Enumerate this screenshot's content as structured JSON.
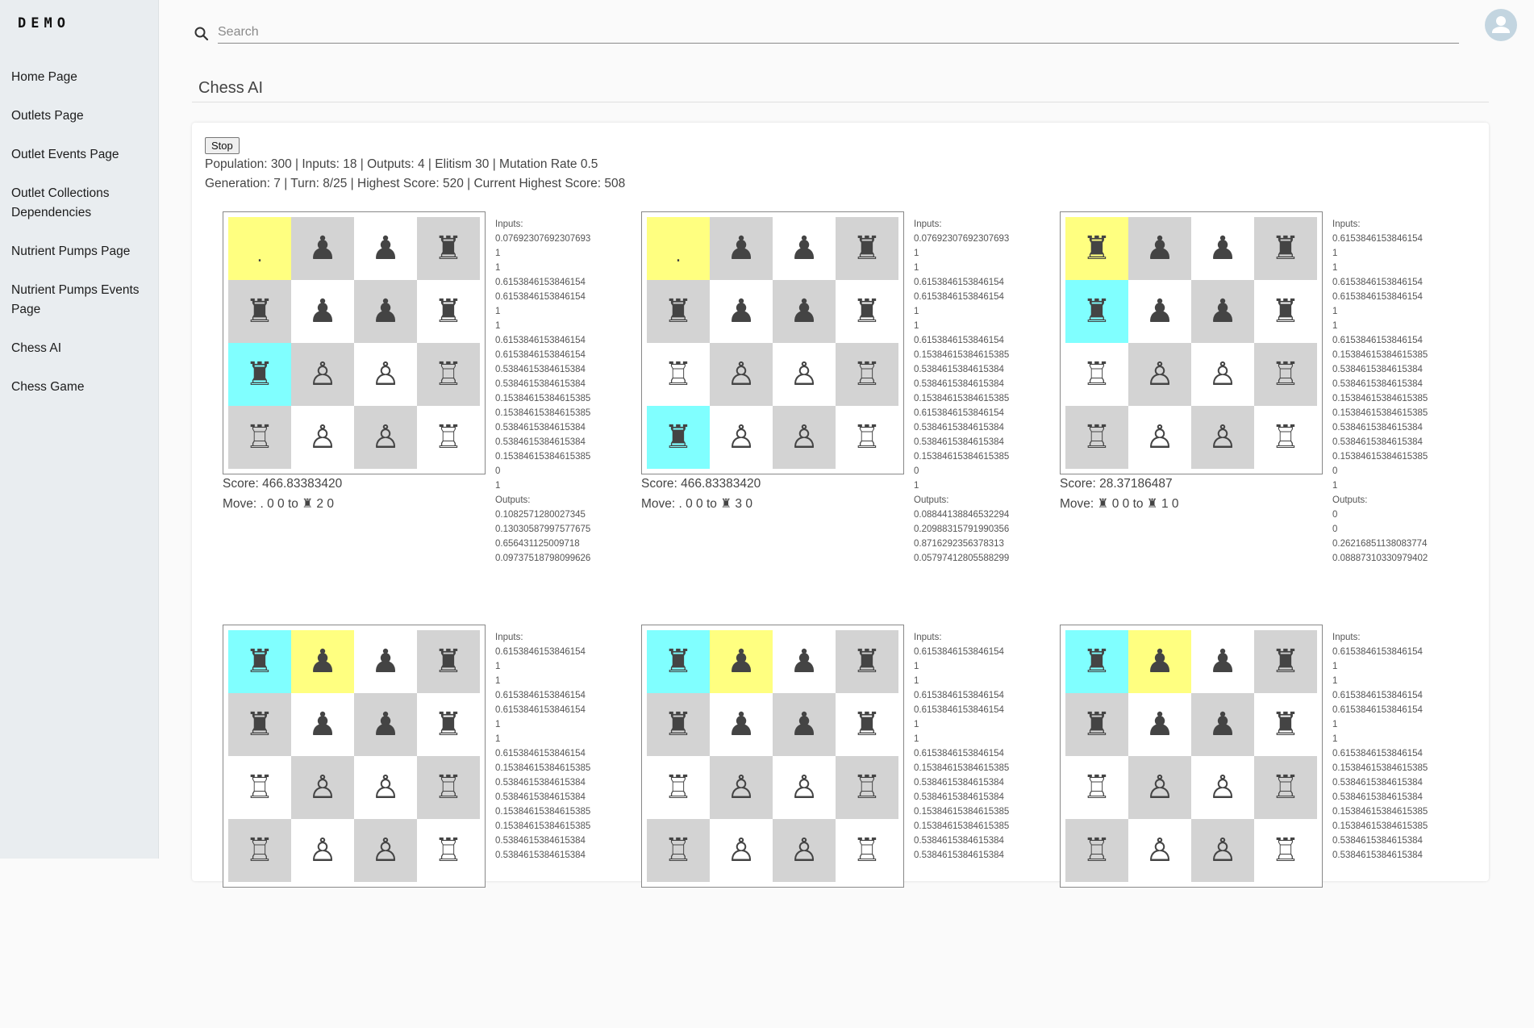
{
  "sidebar": {
    "logo": "DEMO",
    "items": [
      {
        "label": "Home Page"
      },
      {
        "label": "Outlets Page"
      },
      {
        "label": "Outlet Events Page"
      },
      {
        "label": "Outlet Collections Dependencies"
      },
      {
        "label": "Nutrient Pumps Page"
      },
      {
        "label": "Nutrient Pumps Events Page"
      },
      {
        "label": "Chess AI"
      },
      {
        "label": "Chess Game"
      }
    ]
  },
  "header": {
    "search_placeholder": "Search",
    "search_value": "",
    "avatar_icon": "account-circle-icon"
  },
  "page": {
    "title": "Chess AI",
    "stop_label": "Stop",
    "config_line": "Population: 300 | Inputs: 18 | Outputs: 4 | Elitism 30 | Mutation Rate 0.5",
    "status_line": "Generation: 7 | Turn: 8/25 | Highest Score: 520 | Current Highest Score: 508"
  },
  "colors": {
    "from_square": "#ffff80",
    "to_square": "#80ffff",
    "dark_square": "#d3d3d3",
    "light_square": "#ffffff"
  },
  "games": [
    {
      "board": [
        [
          ".",
          "♟",
          "♟",
          "♜"
        ],
        [
          "♜",
          "♟",
          "♟",
          "♜"
        ],
        [
          "♜",
          "♙",
          "♙",
          "♖"
        ],
        [
          "♖",
          "♙",
          "♙",
          "♖"
        ]
      ],
      "highlight_from": [
        0,
        0
      ],
      "highlight_to": [
        2,
        0
      ],
      "score": "Score: 466.83383420",
      "move": "Move: . 0 0 to ♜ 2 0",
      "inputs_label": "Inputs:",
      "inputs": [
        "0.07692307692307693",
        "1",
        "1",
        "0.6153846153846154",
        "0.6153846153846154",
        "1",
        "1",
        "0.6153846153846154",
        "0.6153846153846154",
        "0.5384615384615384",
        "0.5384615384615384",
        "0.15384615384615385",
        "0.15384615384615385",
        "0.5384615384615384",
        "0.5384615384615384",
        "0.15384615384615385",
        "0",
        "1"
      ],
      "outputs_label": "Outputs:",
      "outputs": [
        "0.1082571280027345",
        "0.13030587997577675",
        "0.656431125009718",
        "0.09737518798099626"
      ]
    },
    {
      "board": [
        [
          ".",
          "♟",
          "♟",
          "♜"
        ],
        [
          "♜",
          "♟",
          "♟",
          "♜"
        ],
        [
          "♖",
          "♙",
          "♙",
          "♖"
        ],
        [
          "♜",
          "♙",
          "♙",
          "♖"
        ]
      ],
      "highlight_from": [
        0,
        0
      ],
      "highlight_to": [
        3,
        0
      ],
      "score": "Score: 466.83383420",
      "move": "Move: . 0 0 to ♜ 3 0",
      "inputs_label": "Inputs:",
      "inputs": [
        "0.07692307692307693",
        "1",
        "1",
        "0.6153846153846154",
        "0.6153846153846154",
        "1",
        "1",
        "0.6153846153846154",
        "0.15384615384615385",
        "0.5384615384615384",
        "0.5384615384615384",
        "0.15384615384615385",
        "0.6153846153846154",
        "0.5384615384615384",
        "0.5384615384615384",
        "0.15384615384615385",
        "0",
        "1"
      ],
      "outputs_label": "Outputs:",
      "outputs": [
        "0.08844138846532294",
        "0.20988315791990356",
        "0.8716292356378313",
        "0.05797412805588299"
      ]
    },
    {
      "board": [
        [
          "♜",
          "♟",
          "♟",
          "♜"
        ],
        [
          "♜",
          "♟",
          "♟",
          "♜"
        ],
        [
          "♖",
          "♙",
          "♙",
          "♖"
        ],
        [
          "♖",
          "♙",
          "♙",
          "♖"
        ]
      ],
      "highlight_from": [
        0,
        0
      ],
      "highlight_to": [
        1,
        0
      ],
      "score": "Score: 28.37186487",
      "move": "Move: ♜ 0 0 to ♜ 1 0",
      "inputs_label": "Inputs:",
      "inputs": [
        "0.6153846153846154",
        "1",
        "1",
        "0.6153846153846154",
        "0.6153846153846154",
        "1",
        "1",
        "0.6153846153846154",
        "0.15384615384615385",
        "0.5384615384615384",
        "0.5384615384615384",
        "0.15384615384615385",
        "0.15384615384615385",
        "0.5384615384615384",
        "0.5384615384615384",
        "0.15384615384615385",
        "0",
        "1"
      ],
      "outputs_label": "Outputs:",
      "outputs": [
        "0",
        "0",
        "0.26216851138083774",
        "0.08887310330979402"
      ]
    },
    {
      "board": [
        [
          "♜",
          "♟",
          "♟",
          "♜"
        ],
        [
          "♜",
          "♟",
          "♟",
          "♜"
        ],
        [
          "♖",
          "♙",
          "♙",
          "♖"
        ],
        [
          "♖",
          "♙",
          "♙",
          "♖"
        ]
      ],
      "highlight_from": [
        0,
        1
      ],
      "highlight_to": [
        0,
        0
      ],
      "inputs_label": "Inputs:",
      "inputs": [
        "0.6153846153846154",
        "1",
        "1",
        "0.6153846153846154",
        "0.6153846153846154",
        "1",
        "1",
        "0.6153846153846154",
        "0.15384615384615385",
        "0.5384615384615384",
        "0.5384615384615384",
        "0.15384615384615385",
        "0.15384615384615385",
        "0.5384615384615384",
        "0.5384615384615384"
      ]
    },
    {
      "board": [
        [
          "♜",
          "♟",
          "♟",
          "♜"
        ],
        [
          "♜",
          "♟",
          "♟",
          "♜"
        ],
        [
          "♖",
          "♙",
          "♙",
          "♖"
        ],
        [
          "♖",
          "♙",
          "♙",
          "♖"
        ]
      ],
      "highlight_from": [
        0,
        1
      ],
      "highlight_to": [
        0,
        0
      ],
      "inputs_label": "Inputs:",
      "inputs": [
        "0.6153846153846154",
        "1",
        "1",
        "0.6153846153846154",
        "0.6153846153846154",
        "1",
        "1",
        "0.6153846153846154",
        "0.15384615384615385",
        "0.5384615384615384",
        "0.5384615384615384",
        "0.15384615384615385",
        "0.15384615384615385",
        "0.5384615384615384",
        "0.5384615384615384"
      ]
    },
    {
      "board": [
        [
          "♜",
          "♟",
          "♟",
          "♜"
        ],
        [
          "♜",
          "♟",
          "♟",
          "♜"
        ],
        [
          "♖",
          "♙",
          "♙",
          "♖"
        ],
        [
          "♖",
          "♙",
          "♙",
          "♖"
        ]
      ],
      "highlight_from": [
        0,
        1
      ],
      "highlight_to": [
        0,
        0
      ],
      "inputs_label": "Inputs:",
      "inputs": [
        "0.6153846153846154",
        "1",
        "1",
        "0.6153846153846154",
        "0.6153846153846154",
        "1",
        "1",
        "0.6153846153846154",
        "0.15384615384615385",
        "0.5384615384615384",
        "0.5384615384615384",
        "0.15384615384615385",
        "0.15384615384615385",
        "0.5384615384615384",
        "0.5384615384615384"
      ]
    }
  ]
}
